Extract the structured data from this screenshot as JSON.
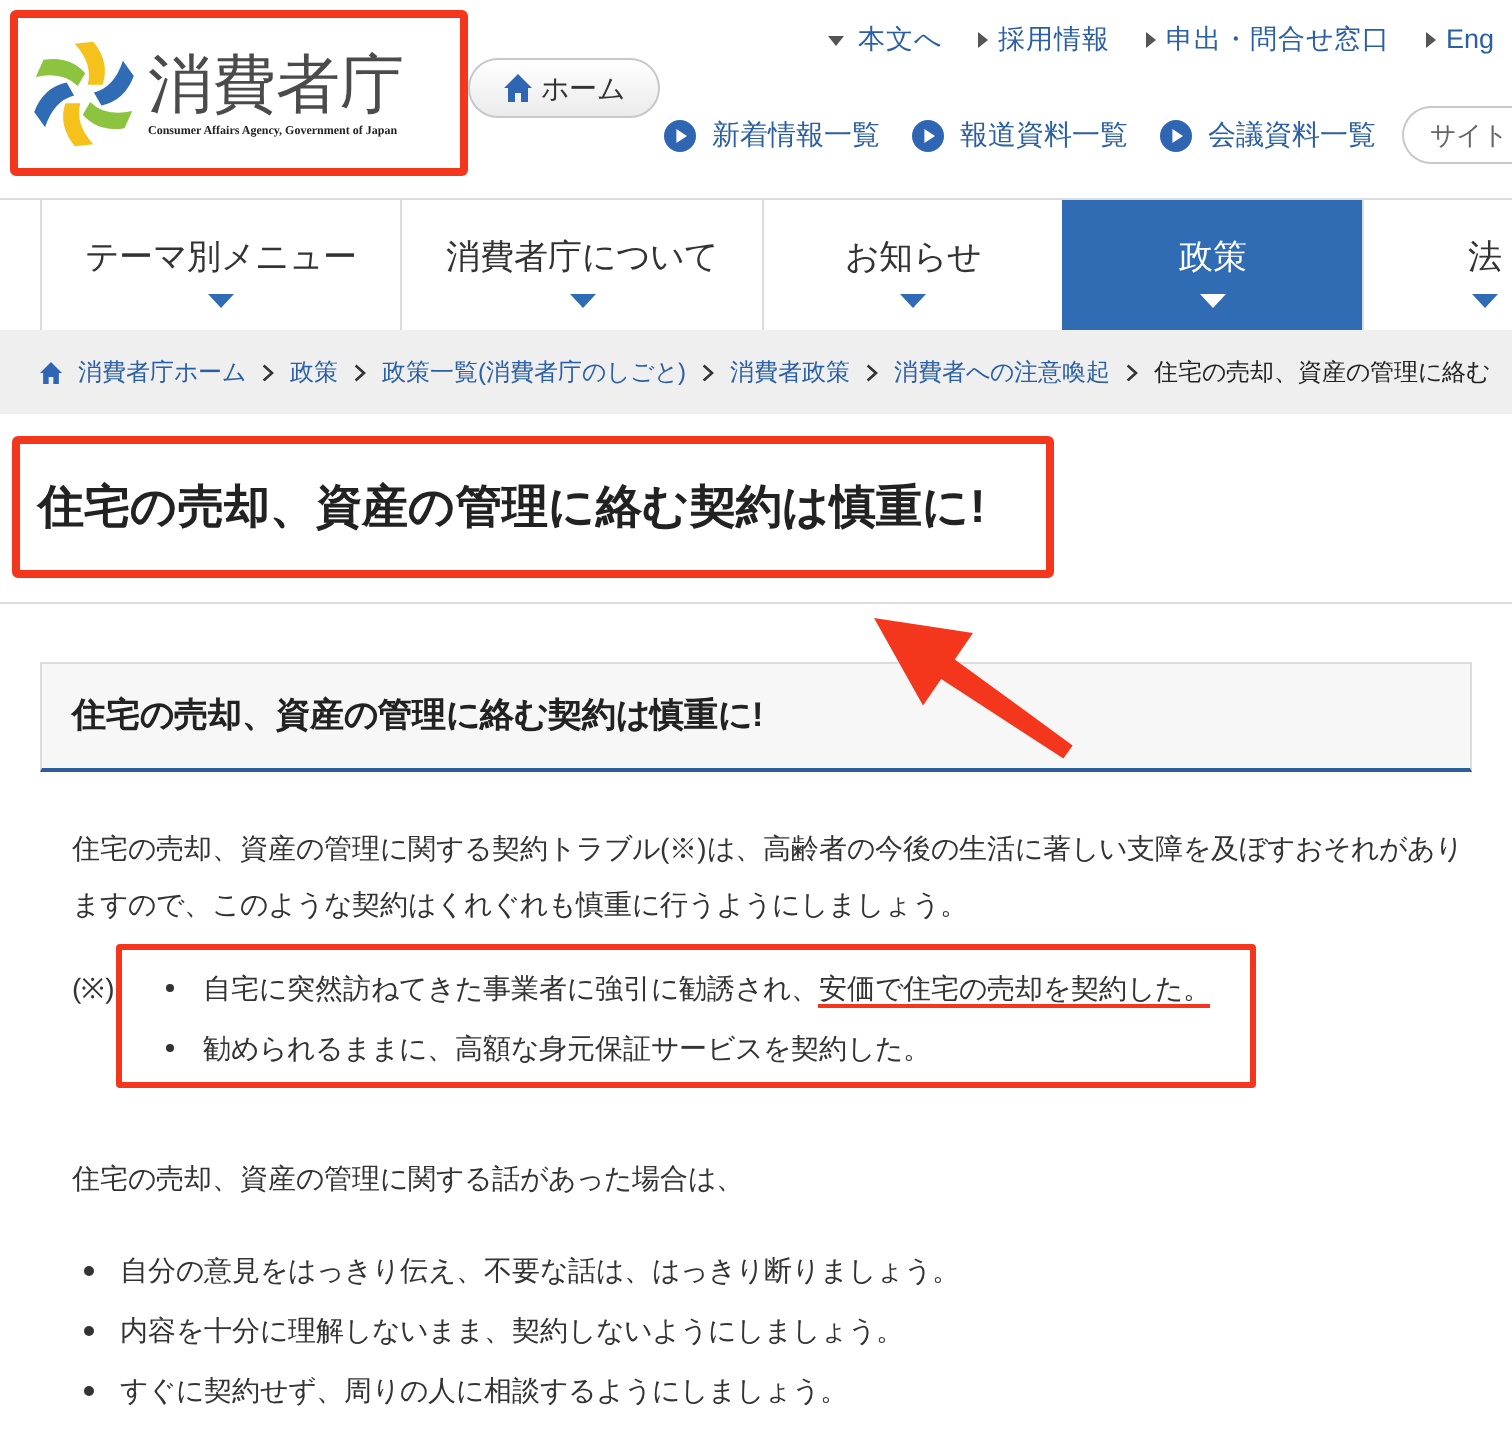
{
  "header": {
    "logo": {
      "wordmark": "消費者庁",
      "subtitle": "Consumer Affairs Agency, Government of Japan",
      "highlighted": true
    },
    "home_button": "ホーム",
    "utility_links": [
      {
        "label": "本文へ",
        "kind": "down"
      },
      {
        "label": "採用情報",
        "kind": "right"
      },
      {
        "label": "申出・問合せ窓口",
        "kind": "right"
      },
      {
        "label": "Eng",
        "kind": "right"
      }
    ],
    "quick_links": [
      "新着情報一覧",
      "報道資料一覧",
      "会議資料一覧"
    ],
    "search": {
      "placeholder": "サイト"
    }
  },
  "nav": {
    "tabs": [
      {
        "label": "テーマ別メニュー",
        "selected": false
      },
      {
        "label": "消費者庁について",
        "selected": false
      },
      {
        "label": "お知らせ",
        "selected": false
      },
      {
        "label": "政策",
        "selected": true
      },
      {
        "label": "法",
        "selected": false
      }
    ]
  },
  "breadcrumb": [
    {
      "label": "消費者庁ホーム",
      "kind": "home"
    },
    {
      "label": "政策",
      "kind": "link"
    },
    {
      "label": "政策一覧(消費者庁のしごと)",
      "kind": "link"
    },
    {
      "label": "消費者政策",
      "kind": "link"
    },
    {
      "label": "消費者への注意喚起",
      "kind": "link"
    },
    {
      "label": "住宅の売却、資産の管理に絡む",
      "kind": "current"
    }
  ],
  "page_title": {
    "text": "住宅の売却、資産の管理に絡む契約は慎重に!",
    "highlighted": true,
    "pointer_arrow": true
  },
  "article": {
    "heading": "住宅の売却、資産の管理に絡む契約は慎重に!",
    "intro": "住宅の売却、資産の管理に関する契約トラブル(※)は、高齢者の今後の生活に著しい支障を及ぼすおそれがありますので、このような契約はくれぐれも慎重に行うようにしましょう。",
    "note": {
      "marker": "(※)",
      "highlighted": true,
      "items": [
        {
          "segments": [
            {
              "text": "自宅に突然訪ねてきた事業者に強引に勧誘され、",
              "underlined": false
            },
            {
              "text": "安価で住宅の売却を契約した。",
              "underlined": true
            }
          ]
        },
        {
          "segments": [
            {
              "text": "勧められるままに、高額な身元保証サービスを契約した。",
              "underlined": false
            }
          ]
        }
      ]
    },
    "lead": "住宅の売却、資産の管理に関する話があった場合は、",
    "tips": [
      "自分の意見をはっきり伝え、不要な話は、はっきり断りましょう。",
      "内容を十分に理解しないまま、契約しないようにしましょう。",
      "すぐに契約せず、周りの人に相談するようにしましょう。"
    ]
  }
}
